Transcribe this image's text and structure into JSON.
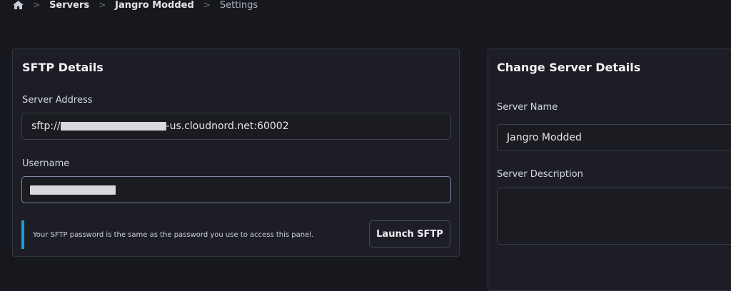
{
  "breadcrumb": {
    "home_icon": "home-icon",
    "items": [
      "Servers",
      "Jangro Modded",
      "Settings"
    ],
    "separator": ">"
  },
  "sftp": {
    "title": "SFTP Details",
    "address_label": "Server Address",
    "address_prefix": "sftp://",
    "address_suffix": "-us.cloudnord.net:60002",
    "username_label": "Username",
    "info_text": "Your SFTP password is the same as the password you use to access this panel.",
    "launch_label": "Launch SFTP",
    "accent": "#1a9bd6"
  },
  "change": {
    "title": "Change Server Details",
    "name_label": "Server Name",
    "name_value": "Jangro Modded",
    "description_label": "Server Description",
    "description_value": ""
  }
}
